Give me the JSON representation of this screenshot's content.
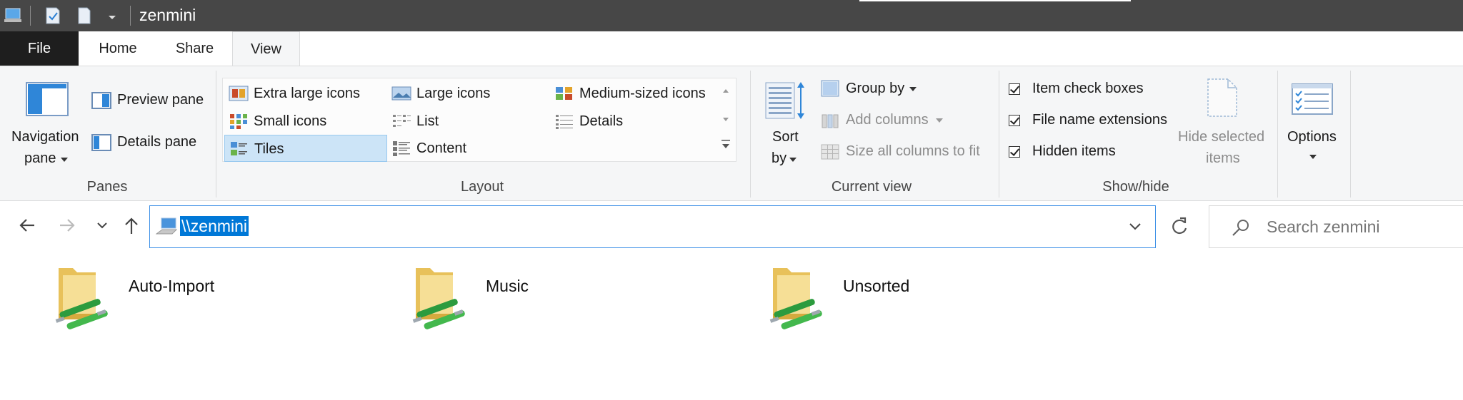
{
  "window": {
    "title": "zenmini"
  },
  "ribbon_tabs": [
    "File",
    "Home",
    "Share",
    "View"
  ],
  "ribbon": {
    "panes": {
      "navigation_pane_line1": "Navigation",
      "navigation_pane_line2": "pane",
      "preview_pane": "Preview pane",
      "details_pane": "Details pane",
      "group_label": "Panes"
    },
    "layout": {
      "items": [
        "Extra large icons",
        "Large icons",
        "Medium-sized icons",
        "Small icons",
        "List",
        "Details",
        "Tiles",
        "Content"
      ],
      "selected": "Tiles",
      "group_label": "Layout"
    },
    "current_view": {
      "sort_by_line1": "Sort",
      "sort_by_line2": "by",
      "group_by": "Group by",
      "add_columns": "Add columns",
      "size_columns": "Size all columns to fit",
      "group_label": "Current view"
    },
    "show_hide": {
      "item_check_boxes": "Item check boxes",
      "file_name_extensions": "File name extensions",
      "hidden_items": "Hidden items",
      "hide_selected_line1": "Hide selected",
      "hide_selected_line2": "items",
      "group_label": "Show/hide",
      "checked": {
        "item_check_boxes": true,
        "file_name_extensions": true,
        "hidden_items": true
      }
    },
    "options": {
      "label": "Options"
    }
  },
  "address_bar": {
    "path": "\\\\zenmini"
  },
  "search": {
    "placeholder": "Search zenmini"
  },
  "folders": [
    {
      "name": "Auto-Import",
      "icon": "network-share-folder-icon"
    },
    {
      "name": "Music",
      "icon": "network-share-folder-icon"
    },
    {
      "name": "Unsorted",
      "icon": "network-share-folder-icon"
    }
  ],
  "colors": {
    "titlebar": "#474747",
    "file_tab": "#1e1e1e",
    "ribbon_bg": "#f5f6f7",
    "selection_blue": "#0078d7",
    "gallery_selected": "#cce4f7"
  }
}
